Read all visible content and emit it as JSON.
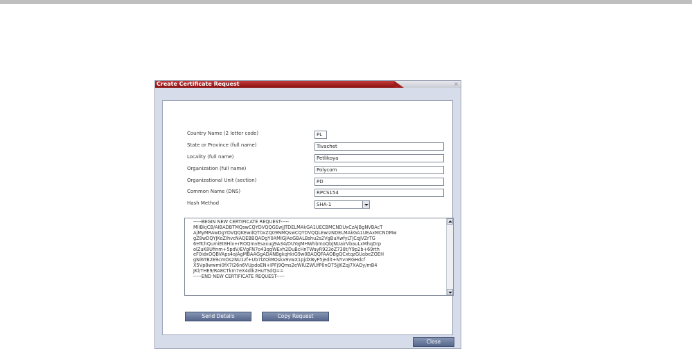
{
  "dialog": {
    "title": "Create Certificate Request",
    "close_glyph": "×"
  },
  "form": {
    "country_label": "Country Name (2 letter code)",
    "country_value": "PL",
    "state_label": "State or Province (full name)",
    "state_value": "Tivachet",
    "locality_label": "Locality (full name)",
    "locality_value": "Petlikoya",
    "organization_label": "Organization (full name)",
    "organization_value": "Polycom",
    "org_unit_label": "Organizational Unit (section)",
    "org_unit_value": "PD",
    "common_name_label": "Common Name (DNS)",
    "common_name_value": "RPCS154",
    "hash_label": "Hash Method",
    "hash_value": "SHA-1"
  },
  "csr": {
    "lines": [
      "-----BEGIN NEW CERTIFICATE REQUEST-----",
      "MIIBkjCB/AIBADBTMQswCQYDVQQGEwJJTDELMAkGA1UECBMCNDUxCzAJBgNVBAcT",
      "AjMyMRAwDgYDVQQKEwdQT0xZQ09NMQswCQYDVQQLEwIzNDELMAkGA1UEAxMCNDMw",
      "gZ8wDQYJKoZIhvcNAQEBBQADgY0AMIGJAoGBALBshu2s2VgBuXwfyLTJCqJVZrTG",
      "6HTchQumiEt8Hlx+rROQmvEsaxug9A34/DUYaJMHWhbmoQbJNUairVbauLxMhqDrp",
      "olZuK8Ufinm+5pdV/EVgFN7o43qqWEvh2DuBcHnTWayR923oZ738t/Y9p2b+69rth",
      "eF0idxOQBVAps4ajAgMBAAGgADANBgkqhkiG9w0BAQQFAAOBgQCxtqzGUabeZOEH",
      "gNi6TB2E9cmOs2NU1zf+Ub7lZOiMOskx9vwX1pjdXByF5jedit+NYvnRGHdcf",
      "X5Vp8wwmi0fX7I26n6VUpdoEN+IPFj9Qms2eWIUZWUfP0nO75jJKZqj7XAOy/mB4",
      "JKl/THE9/RA8CTkm7eX4dlk2HuTSdQ==",
      "-----END NEW CERTIFICATE REQUEST-----"
    ]
  },
  "buttons": {
    "send_details": "Send Details",
    "copy_request": "Copy Request",
    "close": "Close"
  }
}
